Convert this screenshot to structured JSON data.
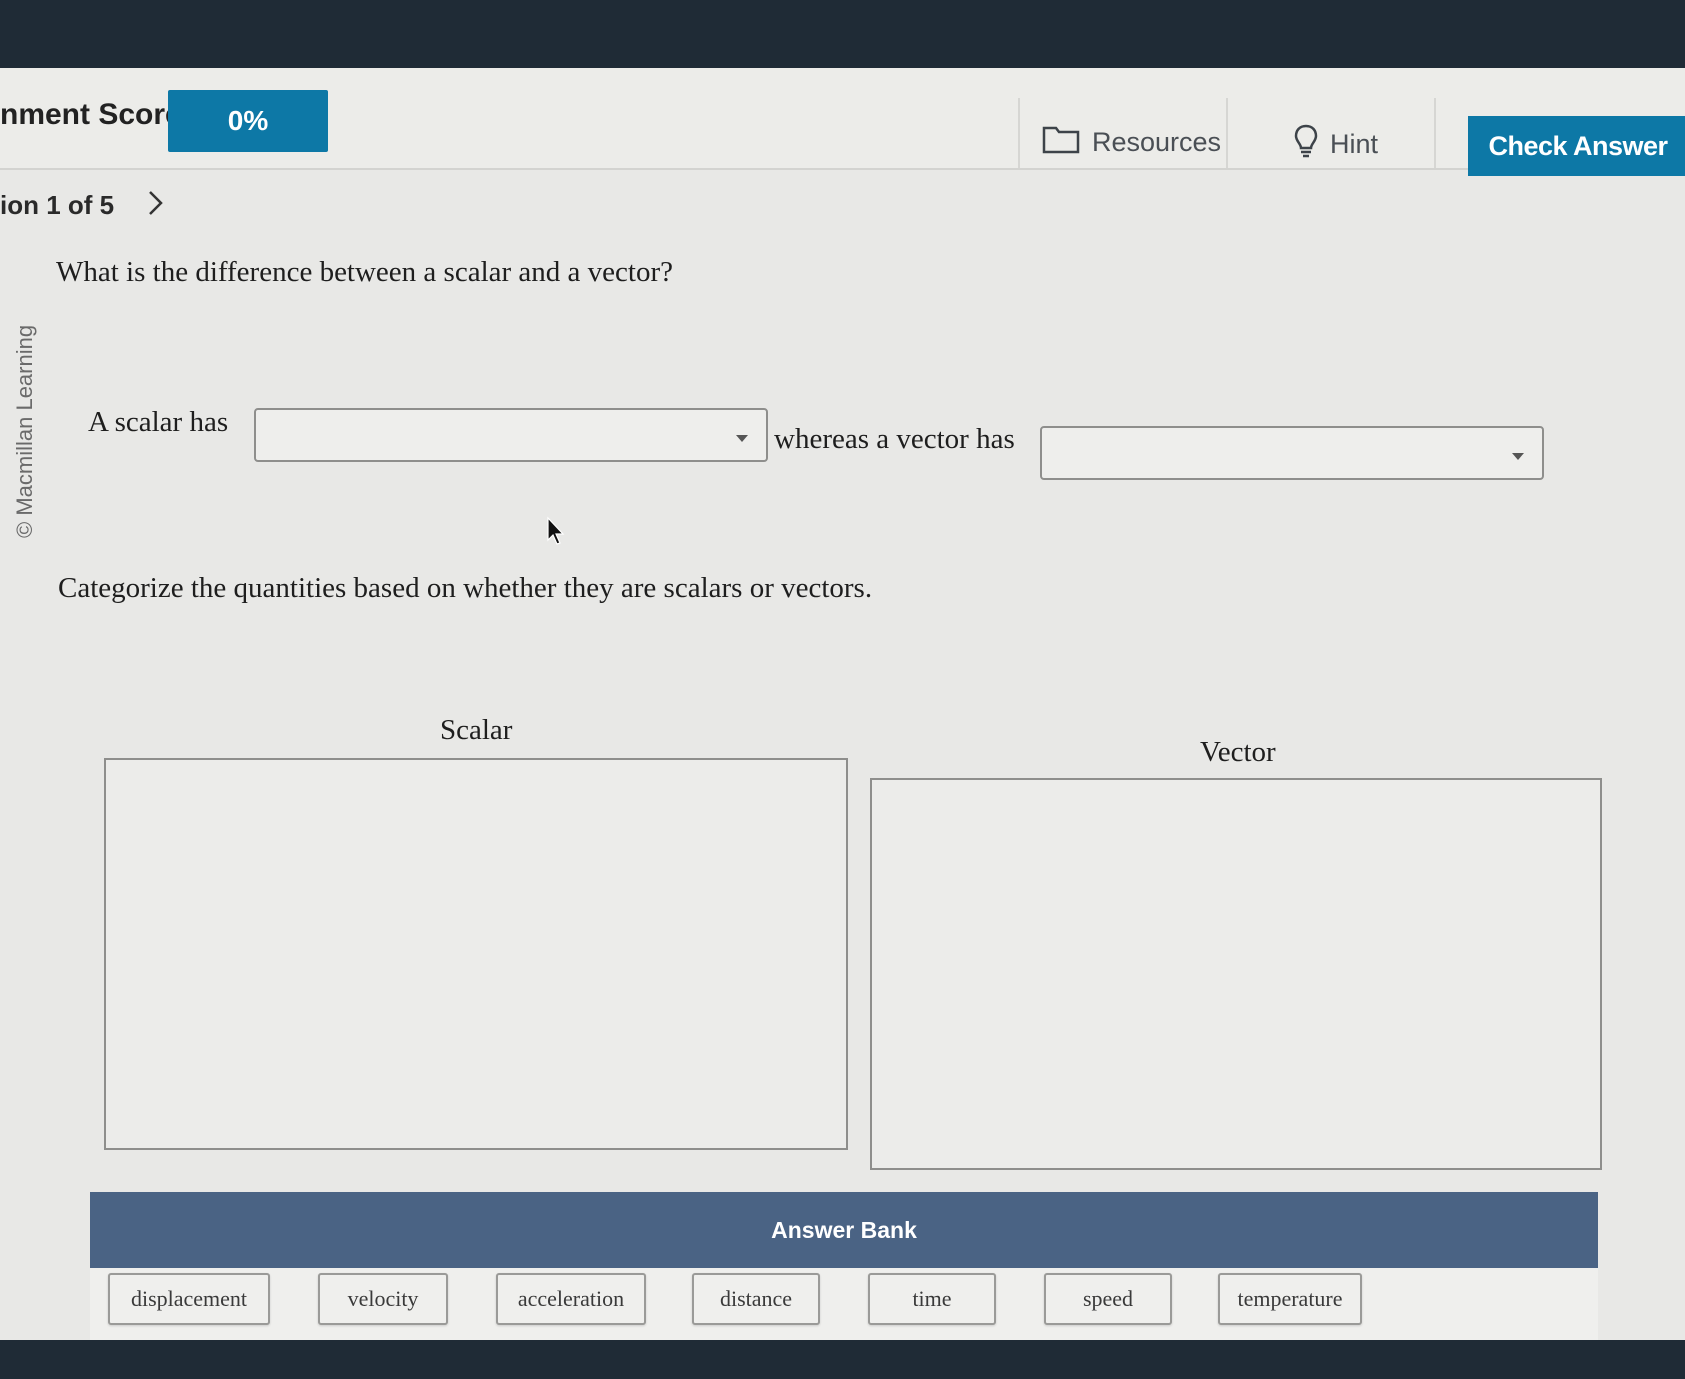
{
  "header": {
    "score_label": "nment Score:",
    "score_value": "0%",
    "resources_label": "Resources",
    "hint_label": "Hint",
    "check_answer_label": "Check Answer"
  },
  "nav": {
    "question_counter": "ion 1 of 5"
  },
  "watermark": "© Macmillan Learning",
  "question1": {
    "prompt": "What is the difference between a scalar and a vector?",
    "sentence_part1": "A scalar has",
    "sentence_part2": "whereas a vector has",
    "dropdown1_value": "",
    "dropdown2_value": ""
  },
  "question2": {
    "prompt": "Categorize the quantities based on whether they are scalars or vectors.",
    "bins": [
      {
        "title": "Scalar"
      },
      {
        "title": "Vector"
      }
    ]
  },
  "answer_bank": {
    "title": "Answer Bank",
    "items": [
      "displacement",
      "velocity",
      "acceleration",
      "distance",
      "time",
      "speed",
      "temperature"
    ]
  },
  "colors": {
    "accent": "#0d78a6",
    "bank_header": "#4a6384"
  }
}
